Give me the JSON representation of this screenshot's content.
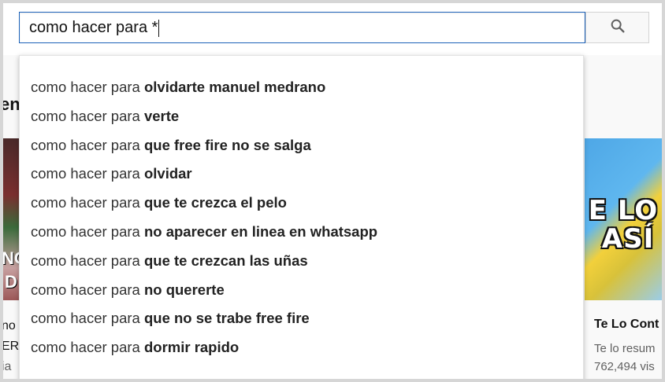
{
  "search": {
    "query": "como hacer para *",
    "button_icon": "search-icon"
  },
  "suggestions": [
    {
      "prefix": "como hacer para ",
      "completion": "olvidarte manuel medrano"
    },
    {
      "prefix": "como hacer para ",
      "completion": "verte"
    },
    {
      "prefix": "como hacer para ",
      "completion": "que free fire no se salga"
    },
    {
      "prefix": "como hacer para ",
      "completion": "olvidar"
    },
    {
      "prefix": "como hacer para ",
      "completion": "que te crezca el pelo"
    },
    {
      "prefix": "como hacer para ",
      "completion": "no aparecer en linea en whatsapp"
    },
    {
      "prefix": "como hacer para ",
      "completion": "que te crezcan las uñas"
    },
    {
      "prefix": "como hacer para ",
      "completion": "no quererte"
    },
    {
      "prefix": "como hacer para ",
      "completion": "que no se trabe free fire"
    },
    {
      "prefix": "como hacer para ",
      "completion": "dormir rapido"
    }
  ],
  "background": {
    "left_heading_fragment": "en",
    "left_thumb_text_1": "NO",
    "left_thumb_text_2": "D",
    "left_line_1": "no",
    "left_line_2": "ER",
    "left_line_3": "ia",
    "right_thumb_text_1": "E LO",
    "right_thumb_text_2": "ASÍ",
    "right_title": "Te Lo Cont",
    "right_sub_1": "Te lo resum",
    "right_sub_2": "762,494 vis"
  }
}
